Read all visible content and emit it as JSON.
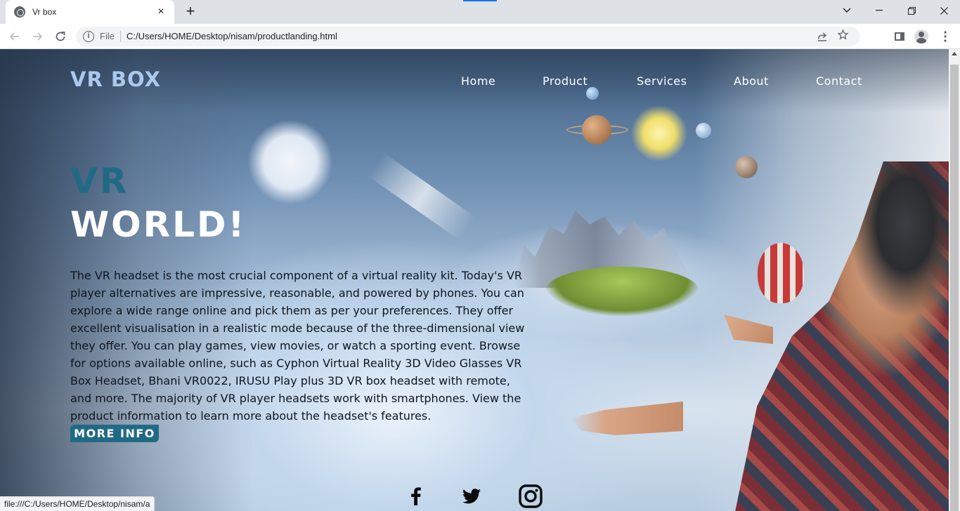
{
  "browser": {
    "tab_title": "Vr box",
    "tab_close": "×",
    "new_tab": "+",
    "scheme_label": "File",
    "url": "C:/Users/HOME/Desktop/nisam/productlanding.html",
    "status_url": "file:///C:/Users/HOME/Desktop/nisam/a",
    "icons": {
      "favicon": "globe-icon",
      "back": "arrow-left-icon",
      "forward": "arrow-right-icon",
      "reload": "reload-icon",
      "info": "info-icon",
      "share": "share-icon",
      "bookmark": "star-icon",
      "side_panel": "side-panel-icon",
      "profile": "profile-icon",
      "menu": "kebab-menu-icon"
    }
  },
  "header": {
    "brand": "VR BOX",
    "nav": [
      "Home",
      "Product",
      "Services",
      "About",
      "Contact"
    ]
  },
  "hero": {
    "title_line1": "VR",
    "title_line2": "WORLD!",
    "body": "The VR headset is the most crucial component of a virtual reality kit. Today's VR player alternatives are impressive, reasonable, and powered by phones. You can explore a wide range online and pick them as per your preferences. They offer excellent visualisation in a realistic mode because of the three-dimensional view they offer. You can play games, view movies, or watch a sporting event. Browse for options available online, such as Cyphon Virtual Reality 3D Video Glasses VR Box Headset, Bhani VR0022, IRUSU Play plus 3D VR box headset with remote, and more. The majority of VR player headsets work with smartphones. View the product information to learn more about the headset's features.",
    "cta": "MORE INFO"
  },
  "social": [
    "facebook-icon",
    "twitter-icon",
    "instagram-icon"
  ],
  "colors": {
    "brand": "#a9c9ee",
    "accent": "#216a86",
    "nav_text": "#ffffff"
  }
}
